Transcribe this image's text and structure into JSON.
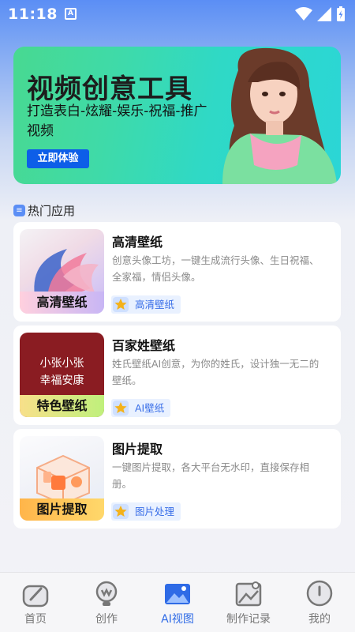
{
  "status_bar": {
    "time": "11:18",
    "notification_letter": "A"
  },
  "banner": {
    "title": "视频创意工具",
    "subtitle": "打造表白-炫耀-娱乐-祝福-推广视频",
    "button_label": "立即体验"
  },
  "section": {
    "title": "热门应用"
  },
  "apps": [
    {
      "thumb_label": "高清壁纸",
      "title": "高清壁纸",
      "description": "创意头像工坊，一键生成流行头像、生日祝福、全家福，情侣头像。",
      "tag": "高清壁纸"
    },
    {
      "thumb_label": "特色壁纸",
      "thumb_text": "小张小张\n幸福安康",
      "title": "百家姓壁纸",
      "description": "姓氏壁纸AI创意，为你的姓氏，设计独一无二的壁纸。",
      "tag": "AI壁纸"
    },
    {
      "thumb_label": "图片提取",
      "title": "图片提取",
      "description": "一键图片提取，各大平台无水印，直接保存相册。",
      "tag": "图片处理"
    }
  ],
  "bottom_nav": [
    {
      "label": "首页",
      "icon": "home-icon",
      "active": false
    },
    {
      "label": "创作",
      "icon": "create-icon",
      "active": false
    },
    {
      "label": "AI视图",
      "icon": "ai-image-icon",
      "active": true
    },
    {
      "label": "制作记录",
      "icon": "records-icon",
      "active": false
    },
    {
      "label": "我的",
      "icon": "profile-icon",
      "active": false
    }
  ],
  "colors": {
    "accent": "#2f6be6",
    "banner_button": "#0d5ee8",
    "tag_bg": "#e9f1ff"
  }
}
